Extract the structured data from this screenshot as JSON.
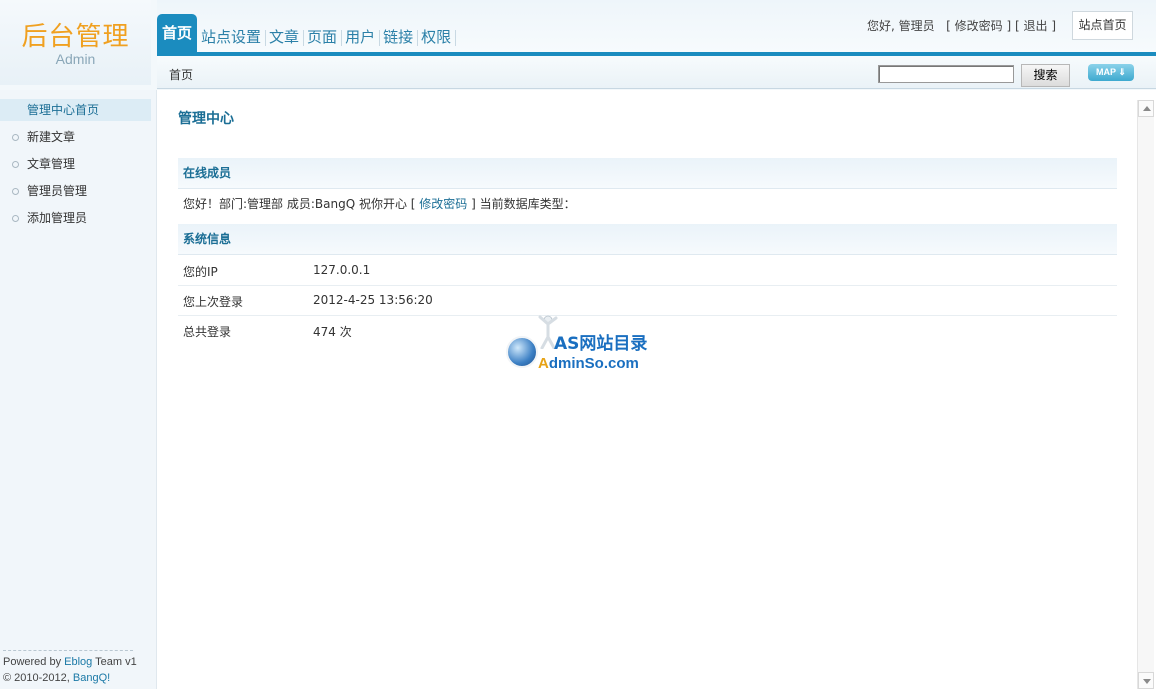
{
  "logo": {
    "title": "后台管理",
    "subtitle": "Admin"
  },
  "nav": {
    "items": [
      {
        "label": "首页",
        "active": true
      },
      {
        "label": "站点设置"
      },
      {
        "label": "文章"
      },
      {
        "label": "页面"
      },
      {
        "label": "用户"
      },
      {
        "label": "链接"
      },
      {
        "label": "权限"
      }
    ]
  },
  "user_area": {
    "greeting": "您好, 管理员",
    "bracket_open": "[",
    "change_password": "修改密码",
    "sep": "] [",
    "logout": "退出",
    "bracket_close": "]",
    "site_home": "站点首页"
  },
  "subbar": {
    "breadcrumb": "首页",
    "search_value": "",
    "search_button": "搜索",
    "map_button": "MAP ⇓"
  },
  "sidebar": {
    "items": [
      {
        "label": "管理中心首页",
        "active": true
      },
      {
        "label": "新建文章"
      },
      {
        "label": "文章管理"
      },
      {
        "label": "管理员管理"
      },
      {
        "label": "添加管理员"
      }
    ],
    "footer": {
      "powered_prefix": "Powered by ",
      "powered_link": "Eblog",
      "powered_suffix": " Team v1",
      "copyright_prefix": "© 2010-2012, ",
      "copyright_link": "BangQ!"
    }
  },
  "main": {
    "title": "管理中心",
    "online": {
      "heading": "在线成员",
      "text_before": "您好！部门:管理部  成员:BangQ 祝你开心 [ ",
      "link": "修改密码",
      "text_after": " ] 当前数据库类型："
    },
    "system": {
      "heading": "系统信息",
      "rows": [
        {
          "key": "您的IP",
          "value": "127.0.0.1"
        },
        {
          "key": "您上次登录",
          "value": "2012-4-25 13:56:20"
        },
        {
          "key": "总共登录",
          "value": "474 次"
        }
      ]
    }
  },
  "watermark": {
    "line1": "AS网站目录",
    "line2_a": "A",
    "line2_rest": "dminSo.com"
  },
  "colors": {
    "accent": "#1b8cbf",
    "logo": "#f0a020",
    "link": "#1b6e95"
  }
}
